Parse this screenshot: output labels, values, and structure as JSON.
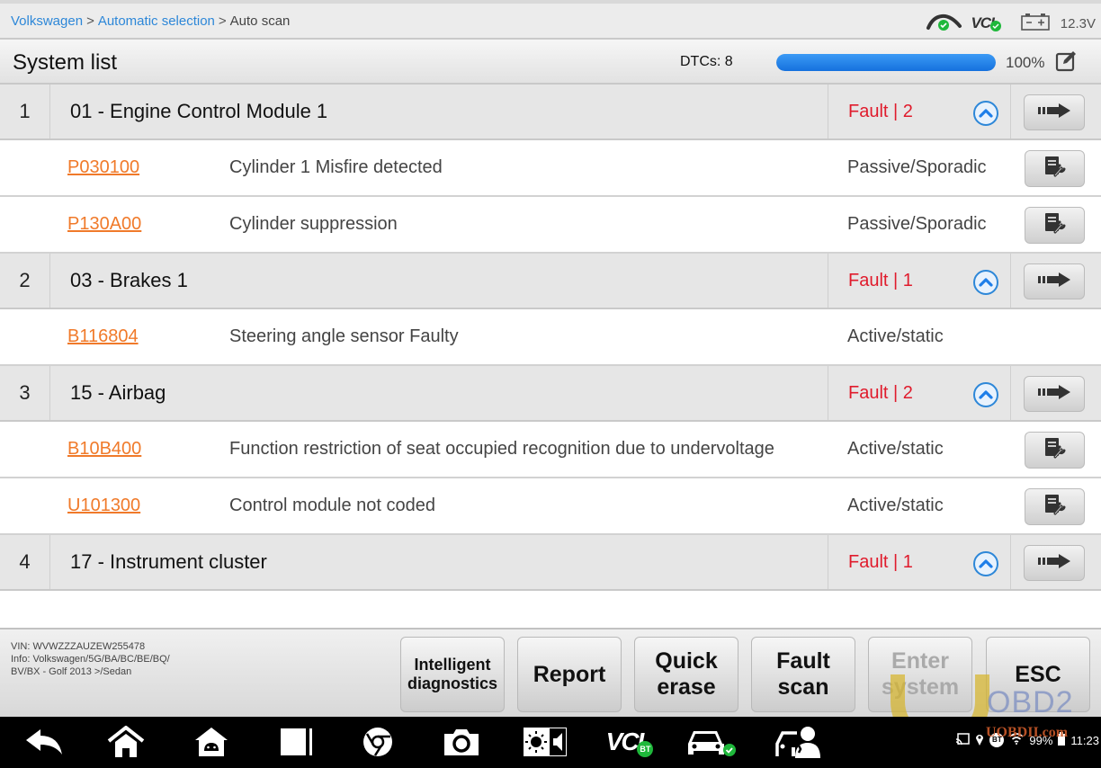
{
  "breadcrumb": {
    "items": [
      {
        "label": "Volkswagen",
        "link": true
      },
      {
        "label": "Automatic selection",
        "link": true
      },
      {
        "label": "Auto scan",
        "link": false
      }
    ],
    "separator": ">"
  },
  "status": {
    "cloud_icon": "cloud-connected-icon",
    "vci_label": "VCI",
    "battery_icon": "battery-icon",
    "voltage": "12.3V"
  },
  "header": {
    "title": "System list",
    "dtcs_label": "DTCs: 8",
    "progress_percent": 100,
    "progress_text": "100%",
    "edit_icon": "edit-icon"
  },
  "systems": [
    {
      "index": "1",
      "name": "01 - Engine Control Module 1",
      "fault": "Fault | 2",
      "dtcs": [
        {
          "code": "P030100",
          "description": "Cylinder 1  Misfire detected",
          "state": "Passive/Sporadic",
          "has_help": true
        },
        {
          "code": "P130A00",
          "description": "Cylinder suppression",
          "state": "Passive/Sporadic",
          "has_help": true
        }
      ]
    },
    {
      "index": "2",
      "name": "03 - Brakes 1",
      "fault": "Fault | 1",
      "dtcs": [
        {
          "code": "B116804",
          "description": "Steering angle sensor  Faulty",
          "state": "Active/static",
          "has_help": false
        }
      ]
    },
    {
      "index": "3",
      "name": "15 - Airbag",
      "fault": "Fault | 2",
      "dtcs": [
        {
          "code": "B10B400",
          "description": "Function restriction of seat occupied recognition  due to undervoltage",
          "state": "Active/static",
          "has_help": true
        },
        {
          "code": "U101300",
          "description": "Control module not coded",
          "state": "Active/static",
          "has_help": true
        }
      ]
    },
    {
      "index": "4",
      "name": "17 - Instrument cluster",
      "fault": "Fault | 1",
      "dtcs": []
    }
  ],
  "footer": {
    "vin": "VIN: WVWZZZAUZEW255478",
    "info_line1": "Info: Volkswagen/5G/BA/BC/BE/BQ/",
    "info_line2": "BV/BX - Golf 2013 >/Sedan",
    "buttons": [
      {
        "label": "Intelligent diagnostics",
        "enabled": true
      },
      {
        "label": "Report",
        "enabled": true
      },
      {
        "label": "Quick erase",
        "enabled": true
      },
      {
        "label": "Fault scan",
        "enabled": true
      },
      {
        "label": "Enter system",
        "enabled": false
      },
      {
        "label": "ESC",
        "enabled": true
      }
    ]
  },
  "navbar": {
    "icons": [
      "back-icon",
      "home-icon",
      "android-home-icon",
      "recent-apps-icon",
      "chrome-icon",
      "camera-icon",
      "brightness-volume-icon",
      "vci-bt-icon",
      "car-connected-icon",
      "remote-expert-icon"
    ],
    "vci_text": "VCI",
    "bt_badge": "BT",
    "system": {
      "battery": "99%",
      "time": "11:23",
      "bt": "BT"
    }
  },
  "watermark": {
    "obd": "OBD2",
    "site": "UOBDII.com"
  },
  "colors": {
    "link_blue": "#2d87d8",
    "fault_red": "#e01b2c",
    "dtc_orange": "#f07a2a",
    "progress_blue": "#1e7ee8",
    "status_green": "#1fb83b"
  }
}
